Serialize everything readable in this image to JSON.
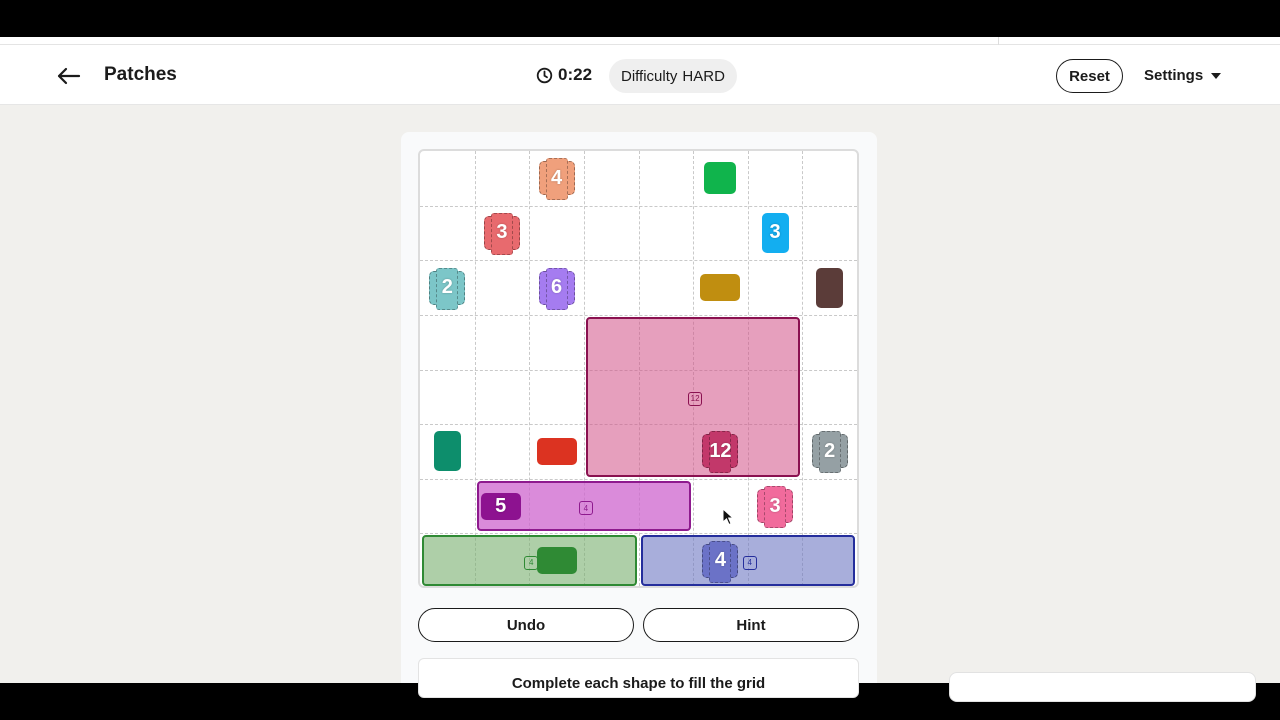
{
  "header": {
    "title": "Patches",
    "timer": "0:22",
    "difficulty_label": "Difficulty",
    "difficulty_value": "HARD",
    "reset_label": "Reset",
    "settings_label": "Settings"
  },
  "board": {
    "cols": 8,
    "rows": 8,
    "clues": [
      {
        "label": "4",
        "row": 0,
        "col": 2,
        "w": 1,
        "h": 1,
        "color": "#f0a07c",
        "style": "hatched"
      },
      {
        "label": "",
        "row": 0,
        "col": 5,
        "w": 1,
        "h": 1,
        "color": "#10b44c",
        "style": "square"
      },
      {
        "label": "3",
        "row": 1,
        "col": 1,
        "w": 1,
        "h": 1,
        "color": "#e86a6e",
        "style": "hatched"
      },
      {
        "label": "3",
        "row": 1,
        "col": 6,
        "w": 1,
        "h": 1,
        "color": "#13aef0",
        "style": "tall"
      },
      {
        "label": "2",
        "row": 2,
        "col": 0,
        "w": 1,
        "h": 1,
        "color": "#7cc6c8",
        "style": "hatched"
      },
      {
        "label": "6",
        "row": 2,
        "col": 2,
        "w": 1,
        "h": 1,
        "color": "#a57cf0",
        "style": "hatched"
      },
      {
        "label": "",
        "row": 2,
        "col": 5,
        "w": 1,
        "h": 1,
        "color": "#c08e10",
        "style": "wide"
      },
      {
        "label": "",
        "row": 2,
        "col": 7,
        "w": 1,
        "h": 1,
        "color": "#5b3c39",
        "style": "tall"
      },
      {
        "label": "",
        "row": 5,
        "col": 0,
        "w": 1,
        "h": 1,
        "color": "#0d8e6c",
        "style": "tall"
      },
      {
        "label": "",
        "row": 5,
        "col": 2,
        "w": 1,
        "h": 1,
        "color": "#dc3321",
        "style": "wide"
      },
      {
        "label": "12",
        "row": 5,
        "col": 5,
        "w": 1,
        "h": 1,
        "color": "#c2386a",
        "style": "hatched"
      },
      {
        "label": "2",
        "row": 5,
        "col": 7,
        "w": 1,
        "h": 1,
        "color": "#95a0a4",
        "style": "hatched"
      },
      {
        "label": "5",
        "row": 6,
        "col": 1,
        "w": 1,
        "h": 1,
        "color": "#8d1290",
        "style": "wide"
      },
      {
        "label": "3",
        "row": 6,
        "col": 6,
        "w": 1,
        "h": 1,
        "color": "#f16b9c",
        "style": "hatched"
      },
      {
        "label": "",
        "row": 7,
        "col": 2,
        "w": 1,
        "h": 1,
        "color": "#2f8a34",
        "style": "wide"
      },
      {
        "label": "4",
        "row": 7,
        "col": 5,
        "w": 1,
        "h": 1,
        "color": "#6b72c7",
        "style": "hatched"
      }
    ],
    "patches": [
      {
        "row": 3,
        "col": 3,
        "w": 4,
        "h": 3,
        "fill": "rgba(210,80,135,0.55)",
        "border": "#8a1150",
        "size_label": "12"
      },
      {
        "row": 6,
        "col": 1,
        "w": 4,
        "h": 1,
        "fill": "rgba(205,100,205,0.75)",
        "border": "#8e1a8e",
        "size_label": "4"
      },
      {
        "row": 7,
        "col": 0,
        "w": 4,
        "h": 1,
        "fill": "rgba(120,175,110,0.6)",
        "border": "#2f8a34",
        "size_label": "4"
      },
      {
        "row": 7,
        "col": 4,
        "w": 4,
        "h": 1,
        "fill": "rgba(110,120,195,0.6)",
        "border": "#252e9c",
        "size_label": "4"
      }
    ]
  },
  "actions": {
    "undo_label": "Undo",
    "hint_label": "Hint"
  },
  "instructions": "Complete each shape to fill the grid"
}
